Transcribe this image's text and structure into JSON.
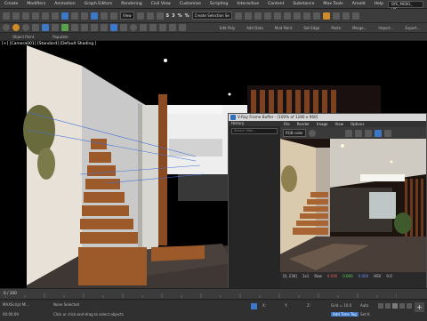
{
  "menubar": {
    "items": [
      "Create",
      "Modifiers",
      "Animation",
      "Graph Editors",
      "Rendering",
      "Civil View",
      "Customize",
      "Scripting",
      "Interactive",
      "Content",
      "Substance",
      "Max Tools",
      "Arnold",
      "Help"
    ],
    "user_label": "BYE_MEBO_ VIS...",
    "workspace": "Workspaces:"
  },
  "toolbar": {
    "view_select": "View",
    "selection_set": "Create Selection Se",
    "labels_row1": [
      "S",
      "3",
      "%",
      "%"
    ],
    "labels_row2": [
      "Object Paint",
      "Populate"
    ],
    "right_labels": [
      "Edit Poly",
      "Add Data",
      "Mod Paint",
      "Set Edge",
      "Paste",
      "Merge...",
      "Import...",
      "Export..."
    ]
  },
  "viewport": {
    "label": "[+] [Camera001] [Standard] [Default Shading ]"
  },
  "vfb": {
    "title": "V-Ray Frame Buffer - [100% of 1280 x 960]",
    "history_label": "History",
    "search_placeholder": "Search filter...",
    "menu": [
      "File",
      "Render",
      "Image",
      "View",
      "Options"
    ],
    "channel_select": "RGB color",
    "status": {
      "coords": "[0, 230]",
      "frame_label": "1x1",
      "raw_label": "Raw",
      "values": [
        "0.000",
        "0.000",
        "0.000"
      ],
      "hsv_label": "HSV",
      "hsv_value": "0.0"
    }
  },
  "timeline": {
    "frame_counter": "0 / 100",
    "ticks": [
      "0",
      "5",
      "10",
      "15",
      "20",
      "25",
      "30",
      "35",
      "40",
      "45",
      "50",
      "55",
      "60",
      "65",
      "70",
      "75",
      "80",
      "85",
      "90",
      "95",
      "100"
    ]
  },
  "statusbar": {
    "maxscript": "MAXScript Mi...",
    "selected": "None Selected",
    "hint": "Click or click-and-drag to select objects",
    "time": "00:00:09",
    "x": "X:",
    "y": "Y:",
    "z": "Z:",
    "grid": "Grid = 10.0",
    "add_time_tag": "Add Time Tag",
    "auto_label": "Auto",
    "setkey_label": "Set K.",
    "selected_label": "Selected",
    "filters_label": "Filters..."
  },
  "colors": {
    "accent": "#3d78c7",
    "wood": "#9a5a2e",
    "floor": "#3d3430"
  }
}
